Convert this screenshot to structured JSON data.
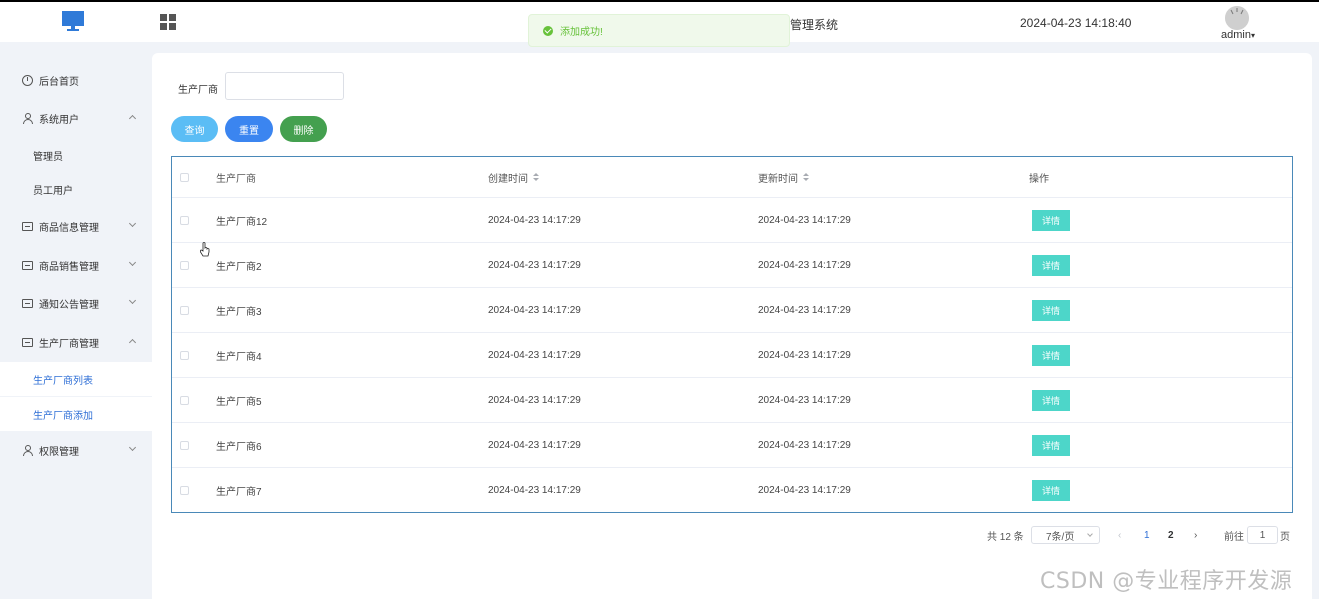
{
  "header": {
    "system_title": "管理系统",
    "datetime": "2024-04-23 14:18:40",
    "user": "admin",
    "user_caret": "▾"
  },
  "toast": {
    "message": "添加成功!",
    "type": "success"
  },
  "sidebar": {
    "items": [
      {
        "label": "后台首页",
        "icon": "clock-icon"
      },
      {
        "label": "系统用户",
        "icon": "user-icon",
        "expanded": true
      },
      {
        "label": "管理员"
      },
      {
        "label": "员工用户"
      },
      {
        "label": "商品信息管理",
        "icon": "box-icon"
      },
      {
        "label": "商品销售管理",
        "icon": "box-icon"
      },
      {
        "label": "通知公告管理",
        "icon": "box-icon"
      },
      {
        "label": "生产厂商管理",
        "icon": "box-icon",
        "expanded": true
      },
      {
        "label": "生产厂商列表",
        "active": true
      },
      {
        "label": "生产厂商添加"
      },
      {
        "label": "权限管理",
        "icon": "user-icon"
      }
    ]
  },
  "filter": {
    "label": "生产厂商",
    "value": ""
  },
  "buttons": {
    "search": "查询",
    "reset": "重置",
    "delete": "删除"
  },
  "table": {
    "headers": {
      "name": "生产厂商",
      "created": "创建时间",
      "updated": "更新时间",
      "op": "操作"
    },
    "rows": [
      {
        "name": "生产厂商12",
        "created": "2024-04-23 14:17:29",
        "updated": "2024-04-23 14:17:29",
        "action": "详情"
      },
      {
        "name": "生产厂商2",
        "created": "2024-04-23 14:17:29",
        "updated": "2024-04-23 14:17:29",
        "action": "详情"
      },
      {
        "name": "生产厂商3",
        "created": "2024-04-23 14:17:29",
        "updated": "2024-04-23 14:17:29",
        "action": "详情"
      },
      {
        "name": "生产厂商4",
        "created": "2024-04-23 14:17:29",
        "updated": "2024-04-23 14:17:29",
        "action": "详情"
      },
      {
        "name": "生产厂商5",
        "created": "2024-04-23 14:17:29",
        "updated": "2024-04-23 14:17:29",
        "action": "详情"
      },
      {
        "name": "生产厂商6",
        "created": "2024-04-23 14:17:29",
        "updated": "2024-04-23 14:17:29",
        "action": "详情"
      },
      {
        "name": "生产厂商7",
        "created": "2024-04-23 14:17:29",
        "updated": "2024-04-23 14:17:29",
        "action": "详情"
      }
    ]
  },
  "pagination": {
    "total": "共 12 条",
    "page_size": "7条/页",
    "prev": "‹",
    "pages": [
      "1",
      "2"
    ],
    "current_page": 1,
    "next": "›",
    "goto_label": "前往",
    "goto_value": "1",
    "page_suffix": "页"
  },
  "watermark": "CSDN @专业程序开发源"
}
